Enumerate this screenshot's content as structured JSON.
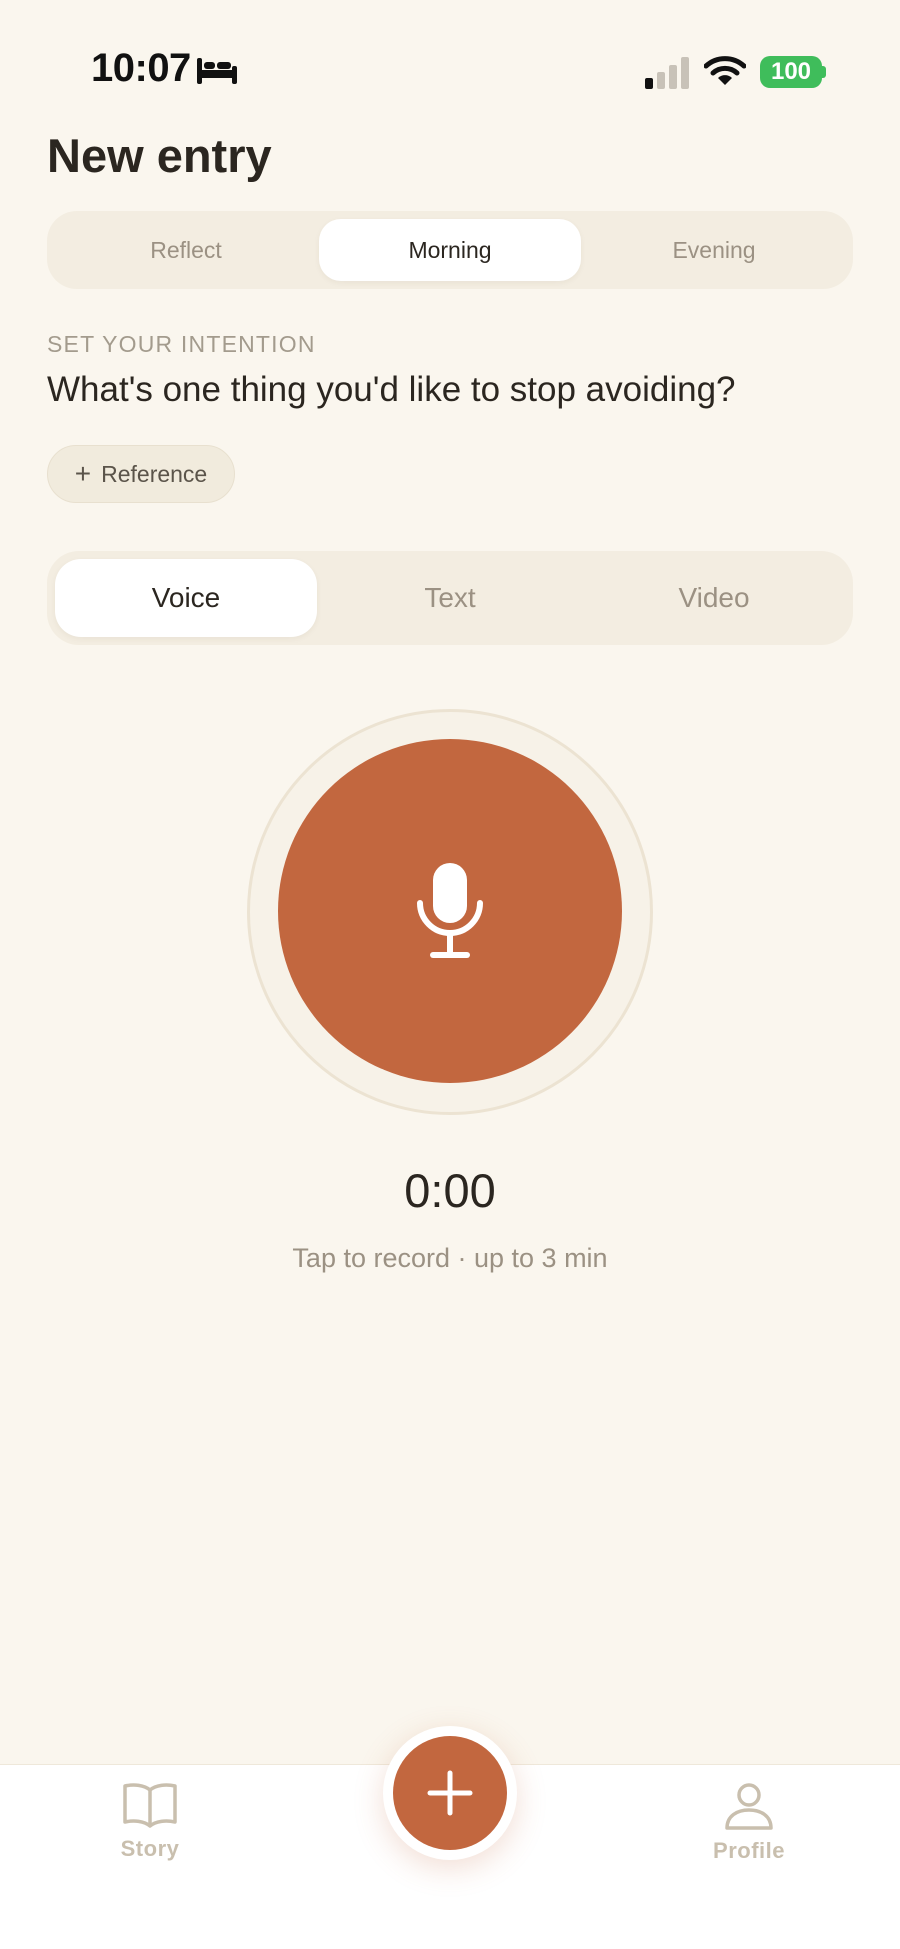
{
  "status_bar": {
    "time": "10:07",
    "battery": "100",
    "icons": [
      "bed-icon",
      "signal-icon",
      "wifi-icon",
      "battery-icon"
    ]
  },
  "header": {
    "title": "New entry"
  },
  "period_tabs": [
    {
      "label": "Reflect",
      "selected": false
    },
    {
      "label": "Morning",
      "selected": true
    },
    {
      "label": "Evening",
      "selected": false
    }
  ],
  "prompt": {
    "label": "SET YOUR INTENTION",
    "question": "What's one thing you'd like to stop avoiding?",
    "reference_label": "Reference"
  },
  "mode_tabs": [
    {
      "label": "Voice",
      "selected": true
    },
    {
      "label": "Text",
      "selected": false
    },
    {
      "label": "Video",
      "selected": false
    }
  ],
  "recorder": {
    "icon": "microphone-icon",
    "timer": "0:00",
    "hint": "Tap to record · up to 3 min"
  },
  "bottom_nav": {
    "story_label": "Story",
    "profile_label": "Profile",
    "add_icon": "plus-icon"
  },
  "colors": {
    "background": "#faf6ee",
    "accent": "#c2673f",
    "segment_bg": "#f3ede1",
    "battery": "#3fbd5b"
  }
}
